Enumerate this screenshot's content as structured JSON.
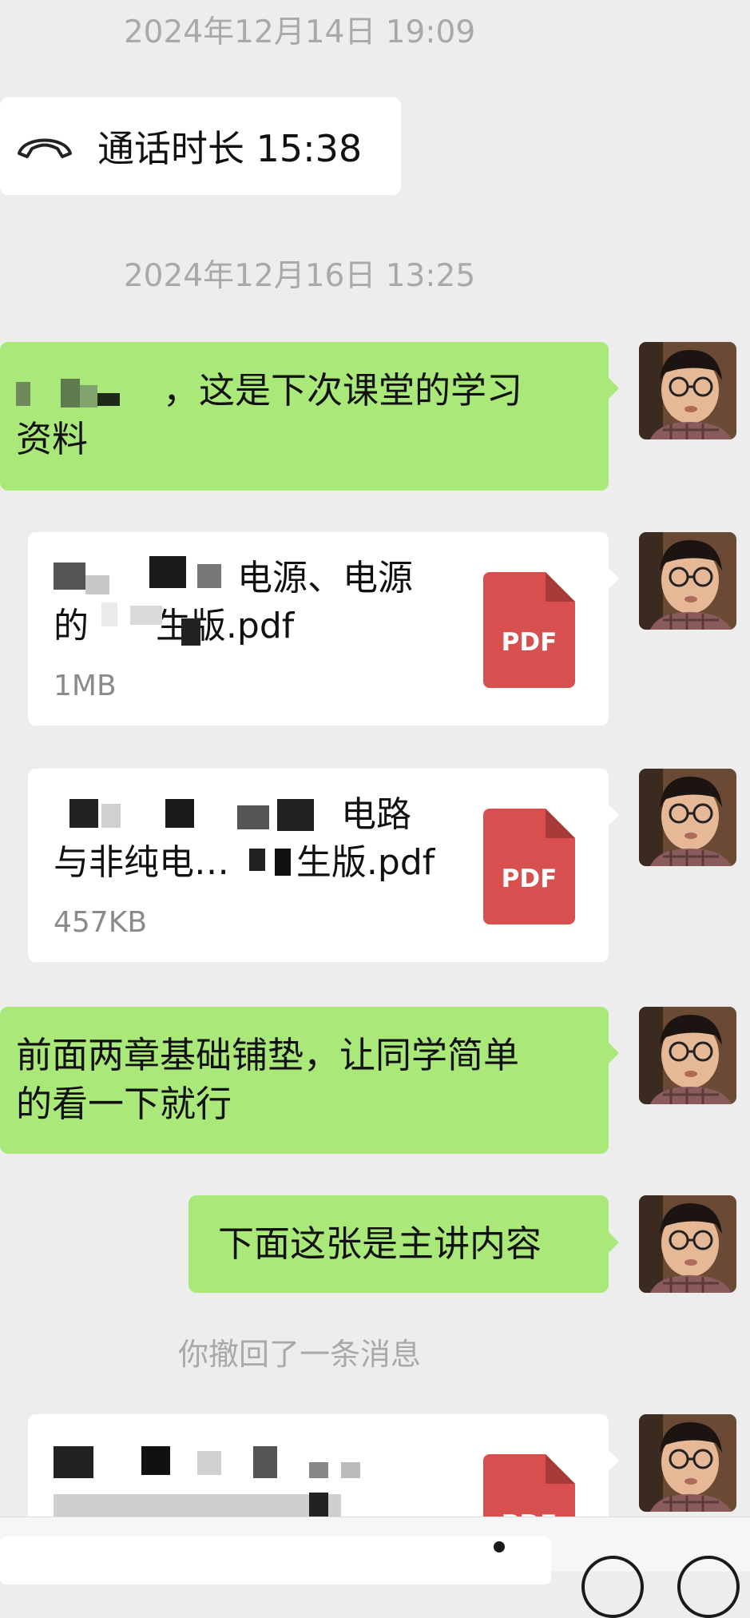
{
  "messages": {
    "ts1": "2024年12月14日 19:09",
    "call_text": "通话时长 15:38",
    "ts2": "2024年12月16日 13:25",
    "msg1_text": "，这是下次课堂的学习\n资料",
    "file1": {
      "name": "电源、电源\n的      生版.pdf",
      "size": "1MB",
      "icon_label": "PDF"
    },
    "file2": {
      "name": "电路\n与非纯电…      生版.pdf",
      "size": "457KB",
      "icon_label": "PDF"
    },
    "msg2_text": "前面两章基础铺垫，让同学简单\n的看一下就行",
    "msg3_text": "下面这张是主讲内容",
    "recall_text": "你撤回了一条消息",
    "file3": {
      "name": "",
      "icon_label": "PDF"
    }
  },
  "icons": {
    "call": "phone-hangup-icon",
    "file": "pdf-icon",
    "voice": "voice-icon"
  },
  "colors": {
    "background": "#ededed",
    "my_bubble": "#a9e879",
    "card": "#ffffff",
    "pdf_red": "#d84f4f",
    "timestamp": "#a9a9a9"
  }
}
